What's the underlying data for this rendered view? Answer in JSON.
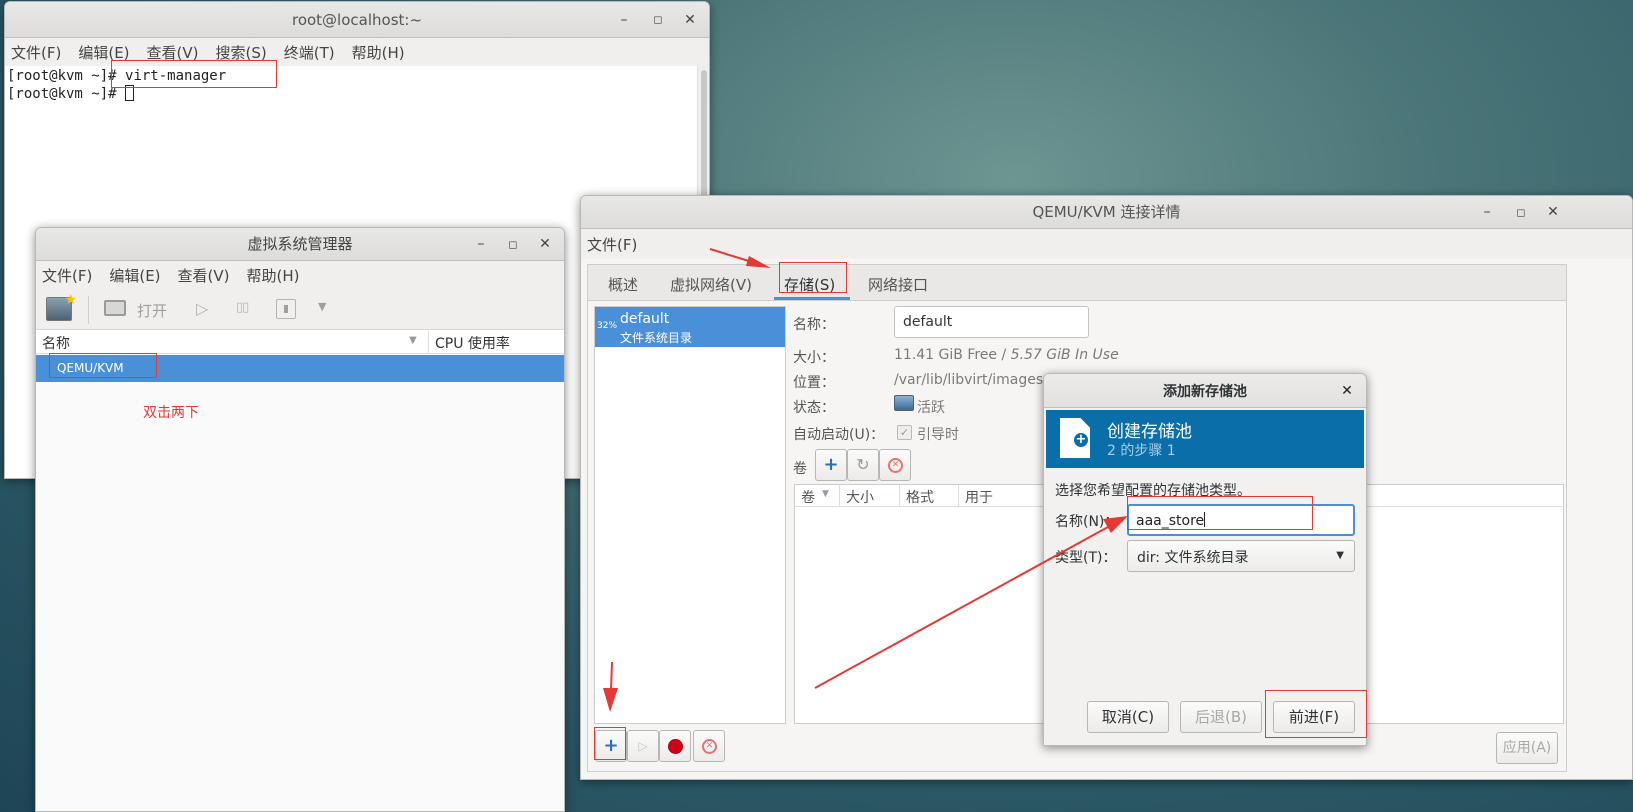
{
  "terminal": {
    "title": "root@localhost:~",
    "menu": [
      "文件(F)",
      "编辑(E)",
      "查看(V)",
      "搜索(S)",
      "终端(T)",
      "帮助(H)"
    ],
    "lines": [
      {
        "prompt": "[root@kvm ~]#",
        "command": "virt-manager"
      },
      {
        "prompt": "[root@kvm ~]#",
        "command": ""
      }
    ]
  },
  "virt_manager": {
    "title": "虚拟系统管理器",
    "menu": [
      "文件(F)",
      "编辑(E)",
      "查看(V)",
      "帮助(H)"
    ],
    "toolbar": {
      "open_label": "打开"
    },
    "columns": {
      "name": "名称",
      "cpu": "CPU 使用率"
    },
    "rows": [
      "QEMU/KVM"
    ],
    "annotation": "双击两下"
  },
  "connection_details": {
    "title": "QEMU/KVM 连接详情",
    "menu": [
      "文件(F)"
    ],
    "tabs": [
      "概述",
      "虚拟网络(V)",
      "存储(S)",
      "网络接口"
    ],
    "pool": {
      "percent": "32%",
      "name": "default",
      "type": "文件系统目录"
    },
    "details": {
      "name_label": "名称：",
      "name_value": "default",
      "size_label": "大小：",
      "size_free": "11.41 GiB Free",
      "size_sep": " / ",
      "size_used": "5.57 GiB In Use",
      "location_label": "位置：",
      "location_value": "/var/lib/libvirt/images",
      "state_label": "状态：",
      "state_value": "活跃",
      "autostart_label": "自动启动(U)：",
      "autostart_value": "引导时",
      "volumes_label": "卷"
    },
    "volume_columns": [
      "卷",
      "大小",
      "格式",
      "用于"
    ],
    "apply_label": "应用(A)"
  },
  "add_pool_dialog": {
    "title": "添加新存储池",
    "header_title": "创建存储池",
    "header_step": "2 的步骤 1",
    "instruction": "选择您希望配置的存储池类型。",
    "name_label": "名称(N)：",
    "name_value": "aaa_store",
    "type_label": "类型(T)：",
    "type_value": "dir: 文件系统目录",
    "buttons": {
      "cancel": "取消(C)",
      "back": "后退(B)",
      "forward": "前进(F)"
    }
  },
  "colors": {
    "selection": "#4a90d9",
    "dialog_header": "#0a6ea8",
    "annotation": "#e53935"
  }
}
